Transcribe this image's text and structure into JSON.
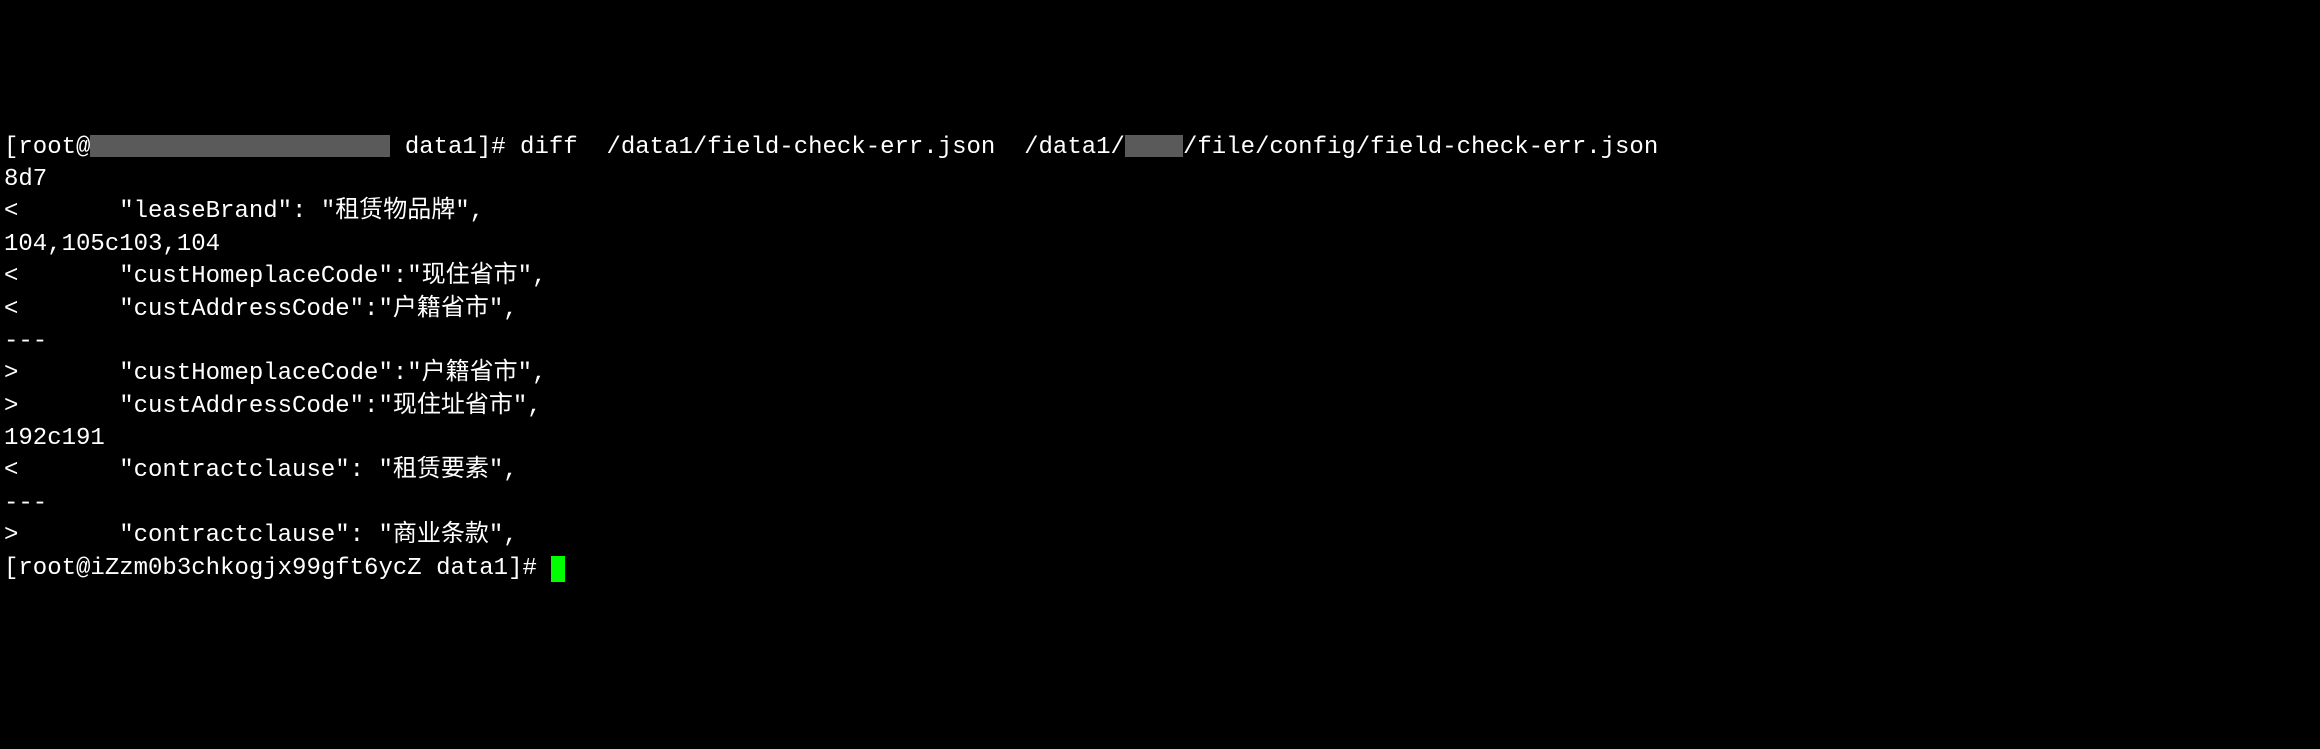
{
  "terminal": {
    "lines": {
      "l1_prefix": "[root@",
      "l1_mid": " data1]# diff  /data1/field-check-err.json  /data1/",
      "l1_suffix": "/file/config/field-check-err.json",
      "l2": "8d7",
      "l3": "<       \"leaseBrand\": \"租赁物品牌\",",
      "l4": "104,105c103,104",
      "l5": "<       \"custHomeplaceCode\":\"现住省市\",",
      "l6": "<       \"custAddressCode\":\"户籍省市\",",
      "l7": "---",
      "l8": ">       \"custHomeplaceCode\":\"户籍省市\",",
      "l9": ">       \"custAddressCode\":\"现住址省市\",",
      "l10": "192c191",
      "l11": "<       \"contractclause\": \"租赁要素\",",
      "l12": "---",
      "l13": ">       \"contractclause\": \"商业条款\",",
      "l14": "[root@iZzm0b3chkogjx99gft6ycZ data1]# "
    }
  }
}
